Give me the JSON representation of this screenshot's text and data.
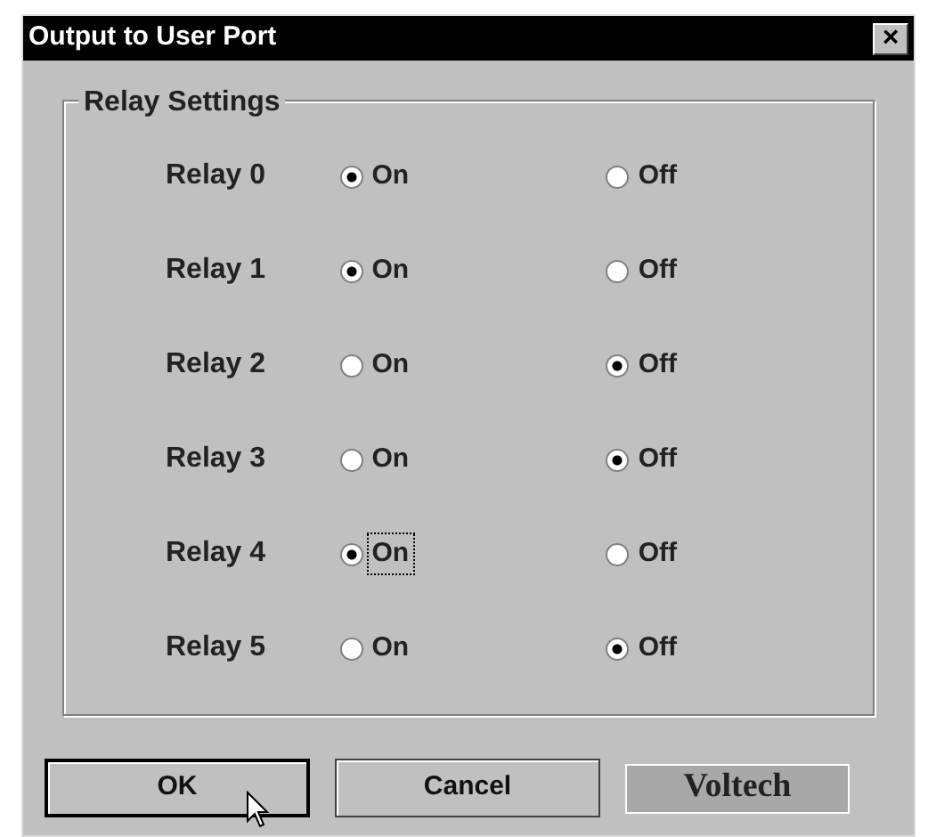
{
  "window": {
    "title": "Output to User Port",
    "close": "×"
  },
  "group": {
    "title": "Relay Settings",
    "rows": [
      {
        "label": "Relay 0",
        "options": [
          {
            "label": "On",
            "selected": true,
            "focused": false
          },
          {
            "label": "Off",
            "selected": false,
            "focused": false
          }
        ]
      },
      {
        "label": "Relay 1",
        "options": [
          {
            "label": "On",
            "selected": true,
            "focused": false
          },
          {
            "label": "Off",
            "selected": false,
            "focused": false
          }
        ]
      },
      {
        "label": "Relay 2",
        "options": [
          {
            "label": "On",
            "selected": false,
            "focused": false
          },
          {
            "label": "Off",
            "selected": true,
            "focused": false
          }
        ]
      },
      {
        "label": "Relay 3",
        "options": [
          {
            "label": "On",
            "selected": false,
            "focused": false
          },
          {
            "label": "Off",
            "selected": true,
            "focused": false
          }
        ]
      },
      {
        "label": "Relay 4",
        "options": [
          {
            "label": "On",
            "selected": true,
            "focused": true
          },
          {
            "label": "Off",
            "selected": false,
            "focused": false
          }
        ]
      },
      {
        "label": "Relay 5",
        "options": [
          {
            "label": "On",
            "selected": false,
            "focused": false
          },
          {
            "label": "Off",
            "selected": true,
            "focused": false
          }
        ]
      }
    ]
  },
  "buttons": [
    {
      "label": "OK",
      "default": true
    },
    {
      "label": "Cancel",
      "default": false
    }
  ],
  "logo": "Voltech"
}
